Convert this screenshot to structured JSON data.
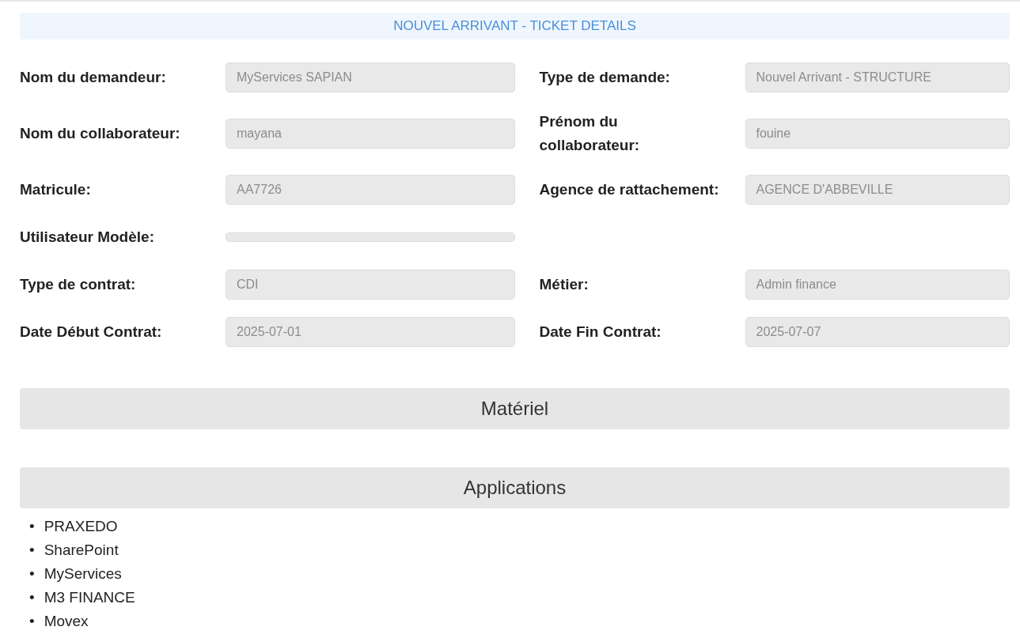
{
  "header": {
    "title": "NOUVEL ARRIVANT - TICKET DETAILS"
  },
  "rows": [
    {
      "left": {
        "label": "Nom du demandeur:",
        "value": "MyServices SAPIAN"
      },
      "right": {
        "label": "Type de demande:",
        "value": "Nouvel Arrivant - STRUCTURE"
      }
    },
    {
      "left": {
        "label": "Nom du collaborateur:",
        "value": "mayana"
      },
      "right": {
        "label": "Prénom du collaborateur:",
        "value": "fouine"
      }
    },
    {
      "left": {
        "label": "Matricule:",
        "value": "AA7726"
      },
      "right": {
        "label": "Agence de rattachement:",
        "value": "AGENCE D'ABBEVILLE"
      }
    },
    {
      "left": {
        "label": "Utilisateur Modèle:"
      }
    },
    {
      "left": {
        "label": "Type de contrat:",
        "value": "CDI"
      },
      "right": {
        "label": "Métier:",
        "value": "Admin finance"
      }
    },
    {
      "left": {
        "label": "Date Début Contrat:",
        "value": "2025-07-01"
      },
      "right": {
        "label": "Date Fin Contrat:",
        "value": "2025-07-07"
      }
    }
  ],
  "sections": [
    {
      "title": "Matériel"
    },
    {
      "title": "Applications",
      "items": [
        {
          "marker": "•",
          "text": "PRAXEDO"
        },
        {
          "marker": "•",
          "text": "SharePoint"
        },
        {
          "marker": "•",
          "text": "MyServices"
        },
        {
          "marker": "•",
          "text": "M3 FINANCE"
        },
        {
          "marker": "•",
          "text": "Movex"
        }
      ]
    }
  ]
}
